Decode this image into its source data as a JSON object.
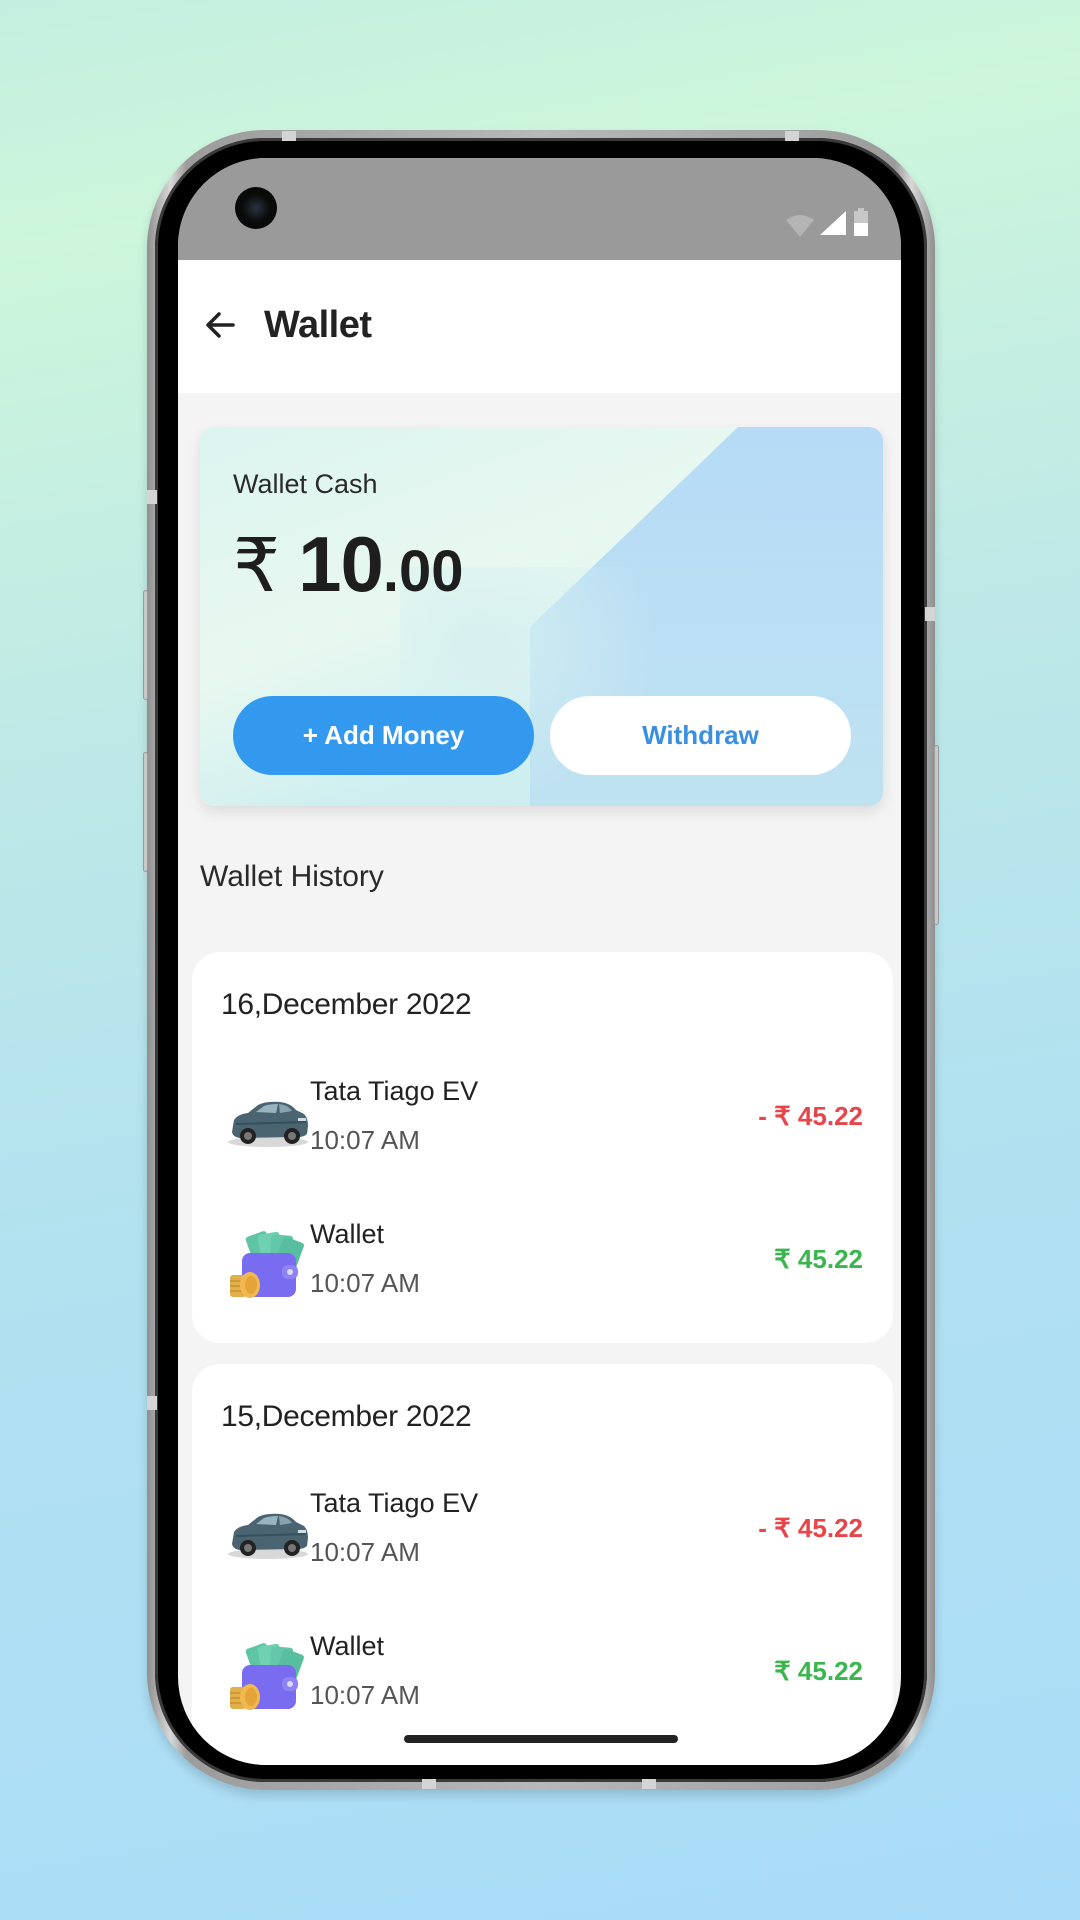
{
  "status_bar": {
    "icons": [
      "wifi-icon",
      "cellular-signal-icon",
      "battery-icon"
    ]
  },
  "header": {
    "back_icon": "arrow-left-icon",
    "title": "Wallet"
  },
  "wallet_card": {
    "label": "Wallet Cash",
    "currency_symbol": "₹",
    "amount_integer": "10",
    "amount_decimal": ".00",
    "add_money_label": "+ Add Money",
    "withdraw_label": "Withdraw",
    "colors": {
      "add_button": "#3399ee",
      "withdraw_text": "#3a8fe0"
    }
  },
  "history": {
    "title": "Wallet History",
    "groups": [
      {
        "date": "16,December 2022",
        "transactions": [
          {
            "icon": "car-icon",
            "name": "Tata Tiago EV",
            "time": "10:07 AM",
            "amount": "- ₹ 45.22",
            "type": "debit"
          },
          {
            "icon": "wallet-icon",
            "name": "Wallet",
            "time": "10:07 AM",
            "amount": "₹ 45.22",
            "type": "credit"
          }
        ]
      },
      {
        "date": "15,December 2022",
        "transactions": [
          {
            "icon": "car-icon",
            "name": "Tata Tiago EV",
            "time": "10:07 AM",
            "amount": "- ₹ 45.22",
            "type": "debit"
          },
          {
            "icon": "wallet-icon",
            "name": "Wallet",
            "time": "10:07 AM",
            "amount": "₹ 45.22",
            "type": "credit"
          }
        ]
      }
    ],
    "colors": {
      "debit": "#e8454b",
      "credit": "#3bb54e"
    }
  }
}
